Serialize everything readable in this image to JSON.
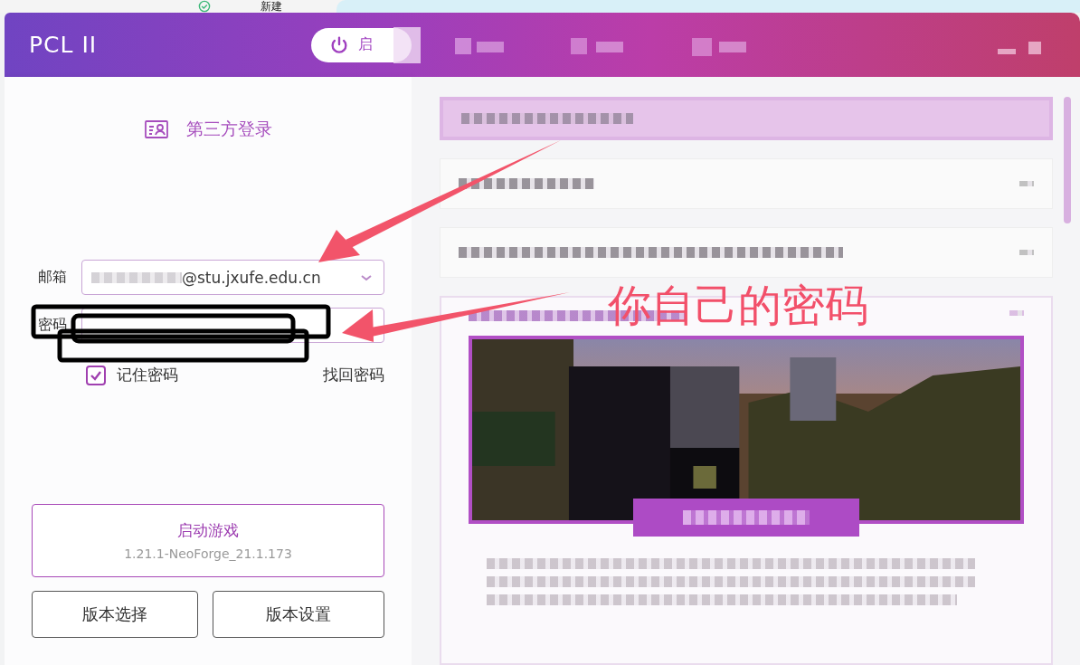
{
  "background_window": {
    "label": "新建",
    "checked": true
  },
  "window": {
    "title": "PCL II"
  },
  "launch_tab": {
    "label": "启",
    "selected": true
  },
  "login": {
    "title": "第三方登录",
    "email_label": "邮箱",
    "email_value": "@stu.jxufe.edu.cn",
    "password_label": "密码",
    "remember": {
      "label": "记住密码",
      "checked": true
    },
    "recover_link": "找回密码"
  },
  "launch_button": {
    "label": "启动游戏",
    "version": "1.21.1-NeoForge_21.1.173"
  },
  "buttons": [
    "版本选择",
    "版本设置"
  ],
  "news_cards": [
    {
      "kind": "banner"
    },
    {
      "kind": "collapsed"
    },
    {
      "kind": "collapsed"
    },
    {
      "kind": "feature"
    }
  ],
  "annotation": {
    "text": "你自己的密码"
  }
}
